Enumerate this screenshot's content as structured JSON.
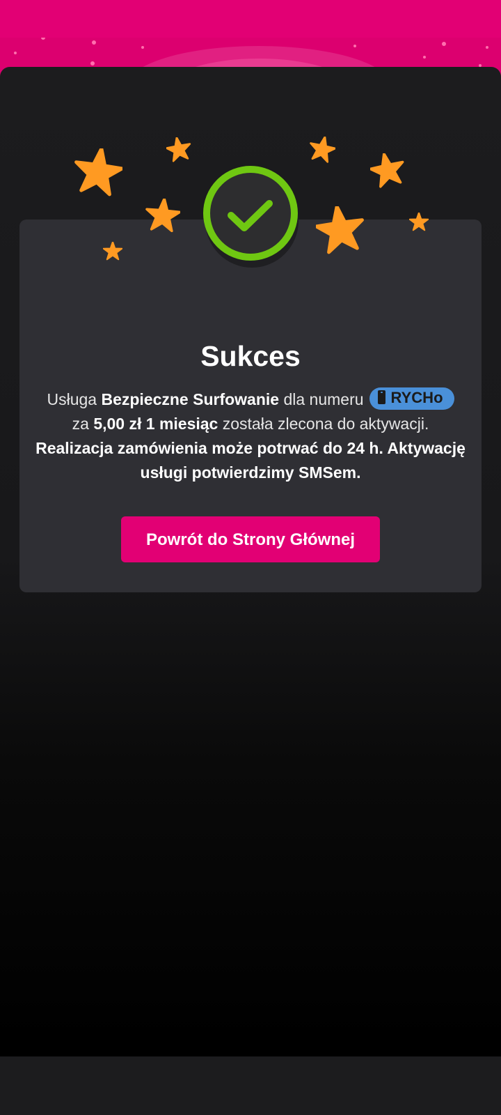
{
  "colors": {
    "brand_magenta": "#e20074",
    "card_background": "#2f2f34",
    "success_green": "#6fc712",
    "star_orange": "#ff9a22",
    "msisdn_pill_blue": "#4a90d9"
  },
  "icons": {
    "success": "check-circle-icon",
    "decoration": "star-icon",
    "msisdn": "phone-icon"
  },
  "success": {
    "title": "Sukces",
    "line1_prefix": "Usługa ",
    "service_name": "Bezpieczne Surfowanie",
    "line1_middle": " dla numeru",
    "msisdn_label": "RYCHo",
    "line2_prefix": "za ",
    "price_period": "5,00 zł 1 miesiąc",
    "line2_suffix": " została zlecona do aktywacji.",
    "notice": "Realizacja zamówienia może potrwać do 24 h. Aktywację usługi potwierdzimy SMSem.",
    "home_button_label": "Powrót do Strony Głównej"
  }
}
